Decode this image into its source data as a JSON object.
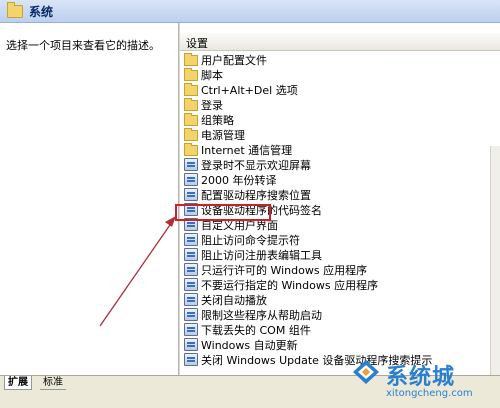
{
  "window": {
    "title": "系统"
  },
  "left_pane": {
    "description": "选择一个项目来查看它的描述。"
  },
  "list": {
    "column_header": "设置",
    "items": [
      {
        "type": "folder",
        "label": "用户配置文件"
      },
      {
        "type": "folder",
        "label": "脚本"
      },
      {
        "type": "folder",
        "label": "Ctrl+Alt+Del 选项"
      },
      {
        "type": "folder",
        "label": "登录"
      },
      {
        "type": "folder",
        "label": "组策略"
      },
      {
        "type": "folder",
        "label": "电源管理"
      },
      {
        "type": "folder",
        "label": "Internet 通信管理"
      },
      {
        "type": "policy",
        "label": "登录时不显示欢迎屏幕"
      },
      {
        "type": "policy",
        "label": "2000 年份转译"
      },
      {
        "type": "policy",
        "label": "配置驱动程序搜索位置"
      },
      {
        "type": "policy",
        "label": "设备驱动程序的代码签名"
      },
      {
        "type": "policy",
        "label": "自定义用户界面",
        "highlighted": true
      },
      {
        "type": "policy",
        "label": "阻止访问命令提示符"
      },
      {
        "type": "policy",
        "label": "阻止访问注册表编辑工具"
      },
      {
        "type": "policy",
        "label": "只运行许可的 Windows 应用程序"
      },
      {
        "type": "policy",
        "label": "不要运行指定的 Windows 应用程序"
      },
      {
        "type": "policy",
        "label": "关闭自动播放"
      },
      {
        "type": "policy",
        "label": "限制这些程序从帮助启动"
      },
      {
        "type": "policy",
        "label": "下载丢失的 COM 组件"
      },
      {
        "type": "policy",
        "label": "Windows 自动更新"
      },
      {
        "type": "policy",
        "label": "关闭 Windows Update 设备驱动程序搜索提示"
      }
    ]
  },
  "tabs": [
    {
      "label": "扩展"
    },
    {
      "label": "标准"
    }
  ],
  "watermark": {
    "brand": "系统城",
    "url": "xitongcheng.com"
  },
  "colors": {
    "highlight_box": "#c8232c",
    "arrow": "#b0303a",
    "watermark": "#2a7fcf"
  }
}
